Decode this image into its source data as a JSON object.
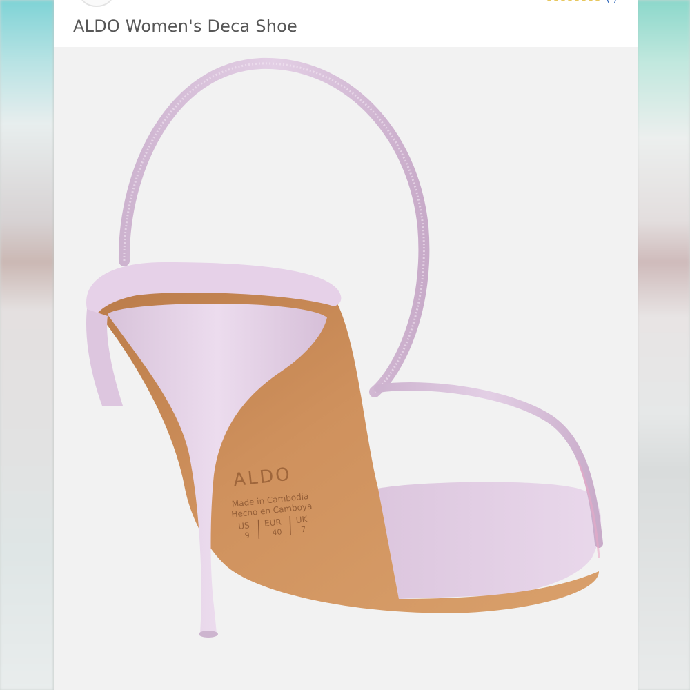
{
  "listing": {
    "title": "ALDO Women's Deca Shoe"
  },
  "image": {
    "sole_brand": "ALDO",
    "sole_text_line1": "Made in Cambodia",
    "sole_text_line2": "Hecho en Camboya",
    "size_headers": [
      "US",
      "EUR",
      "UK"
    ],
    "size_values": [
      "9",
      "40",
      "7"
    ]
  },
  "colors": {
    "background": "#f2f2f2",
    "shoe": "#e7d3e8",
    "sole": "#c98a57",
    "title_text": "#575757"
  }
}
